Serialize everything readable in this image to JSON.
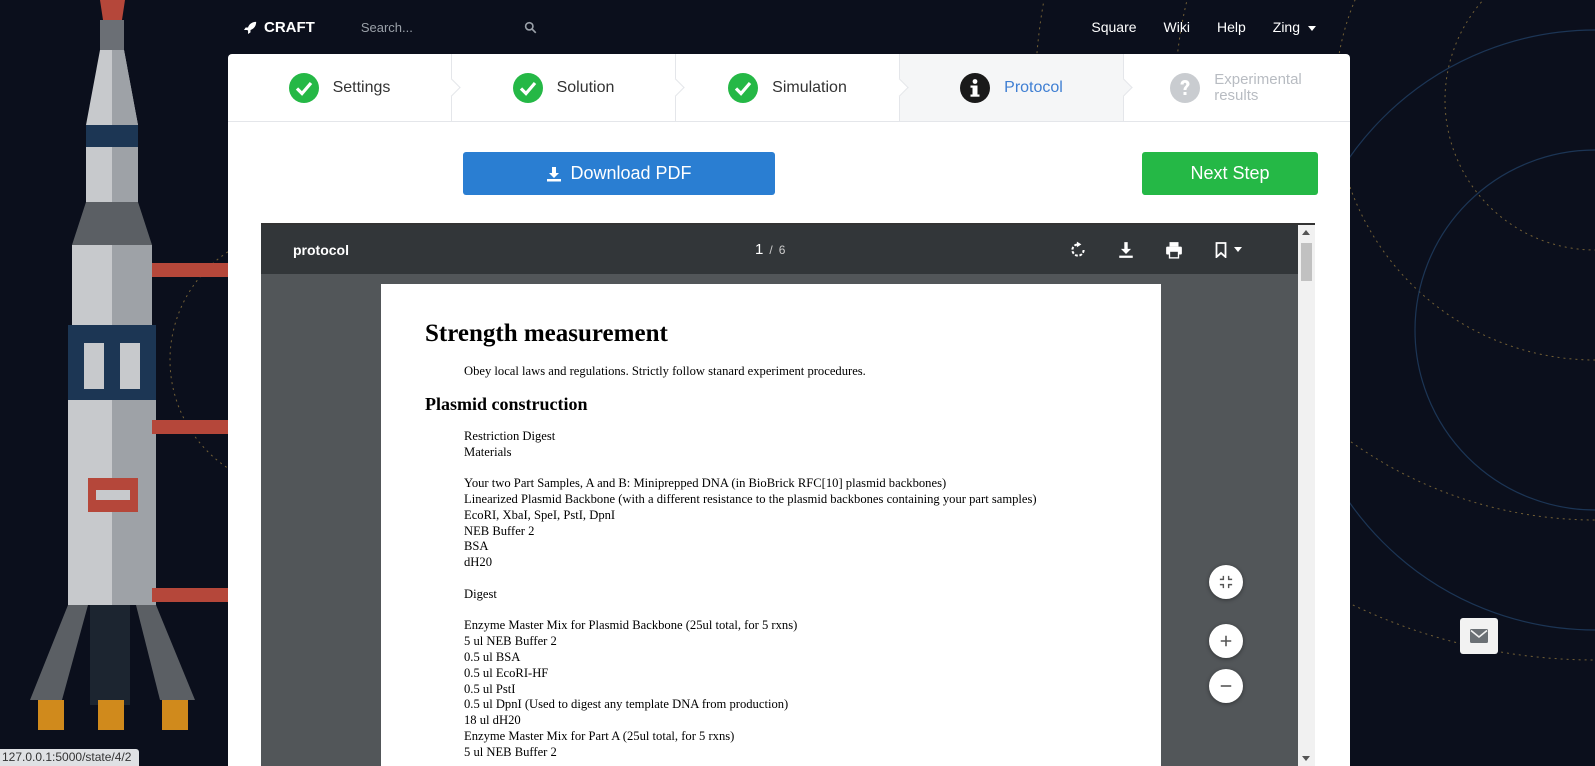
{
  "navbar": {
    "brand": "CRAFT",
    "search_placeholder": "Search...",
    "links": [
      "Square",
      "Wiki",
      "Help"
    ],
    "user": "Zing"
  },
  "steps": [
    {
      "label": "Settings",
      "state": "done",
      "icon": "check-circle-icon"
    },
    {
      "label": "Solution",
      "state": "done",
      "icon": "check-circle-icon"
    },
    {
      "label": "Simulation",
      "state": "done",
      "icon": "check-circle-icon"
    },
    {
      "label": "Protocol",
      "state": "active",
      "icon": "info-circle-icon"
    },
    {
      "label_line1": "Experimental",
      "label_line2": "results",
      "state": "disabled",
      "icon": "question-circle-icon"
    }
  ],
  "actions": {
    "download_label": "Download PDF",
    "next_label": "Next Step"
  },
  "viewer": {
    "title": "protocol",
    "current_page": "1",
    "separator": "/",
    "total_pages": "6"
  },
  "document": {
    "title": "Strength measurement",
    "intro": "Obey local laws and regulations. Strictly follow stanard experiment procedures.",
    "section": "Plasmid construction",
    "lines": [
      "Restriction Digest",
      "Materials",
      "",
      "Your two Part Samples, A and B: Miniprepped DNA (in BioBrick RFC[10] plasmid backbones)",
      "Linearized Plasmid Backbone (with a different resistance to the plasmid backbones containing your part samples)",
      "EcoRI, XbaI, SpeI, PstI, DpnI",
      "NEB Buffer 2",
      "BSA",
      "dH20",
      "",
      "Digest",
      "",
      "Enzyme Master Mix for Plasmid Backbone (25ul total, for 5 rxns)",
      "5 ul NEB Buffer 2",
      "0.5 ul BSA",
      "0.5 ul EcoRI-HF",
      "0.5 ul PstI",
      "0.5 ul DpnI (Used to digest any template DNA from production)",
      "18 ul dH20",
      "Enzyme Master Mix for Part A (25ul total, for 5 rxns)",
      "5 ul NEB Buffer 2"
    ]
  },
  "status_url": "127.0.0.1:5000/state/4/2",
  "colors": {
    "primary": "#2a7ed2",
    "success": "#25b846",
    "active_step": "#3f7fd3",
    "background": "#0b0f1c"
  }
}
